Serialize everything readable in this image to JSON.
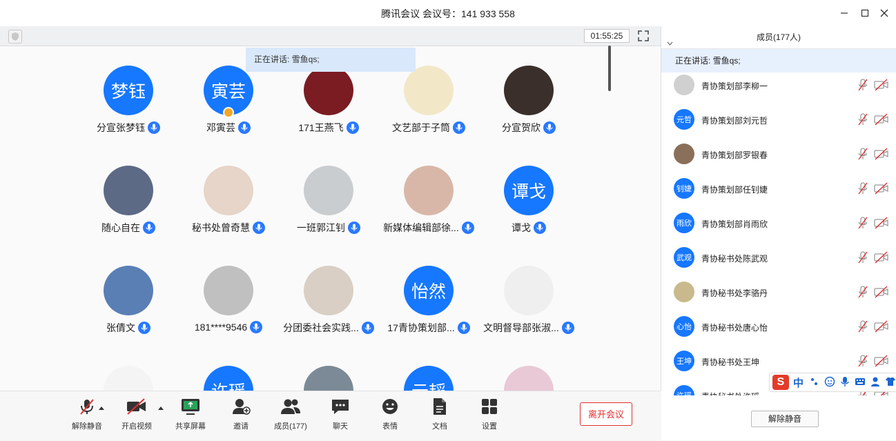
{
  "window": {
    "title": "腾讯会议 会议号：141 933 558"
  },
  "meeting": {
    "timer": "01:55:25",
    "speaking": "正在讲话: 雪鱼qs;"
  },
  "gallery": {
    "rows": [
      [
        {
          "avatar_text": "梦钰",
          "name": "分宣张梦钰"
        },
        {
          "avatar_text": "寅芸",
          "name": "邓寅芸",
          "host_badge": true
        },
        {
          "avatar_text": "",
          "name": "171王燕飞",
          "avatar_color": "#7a1c22"
        },
        {
          "avatar_text": "",
          "name": "文艺部于子筒",
          "avatar_color": "#f2e8c8"
        },
        {
          "avatar_text": "",
          "name": "分宣贺欣",
          "avatar_color": "#3a2f2a"
        }
      ],
      [
        {
          "avatar_text": "",
          "name": "随心自在",
          "avatar_color": "#5c6a86"
        },
        {
          "avatar_text": "",
          "name": "秘书处曾奇慧",
          "avatar_color": "#e6d5c8"
        },
        {
          "avatar_text": "",
          "name": "一班郭江钊",
          "avatar_color": "#c9cdd0"
        },
        {
          "avatar_text": "",
          "name": "新媒体编辑部徐...",
          "avatar_color": "#d8b7a8"
        },
        {
          "avatar_text": "谭戈",
          "name": "谭戈"
        }
      ],
      [
        {
          "avatar_text": "",
          "name": "张倩文",
          "avatar_color": "#5a7fb5"
        },
        {
          "avatar_text": "",
          "name": "181****9546",
          "avatar_color": "#c0c0c0"
        },
        {
          "avatar_text": "",
          "name": "分团委社会实践...",
          "avatar_color": "#d9cfc4"
        },
        {
          "avatar_text": "怡然",
          "name": "17青协策划部..."
        },
        {
          "avatar_text": "",
          "name": "文明督导部张淑...",
          "avatar_color": "#efefef"
        }
      ],
      [
        {
          "avatar_text": "",
          "name": "",
          "avatar_color": "#f4f4f4"
        },
        {
          "avatar_text": "许瑶",
          "name": ""
        },
        {
          "avatar_text": "",
          "name": "",
          "avatar_color": "#7b8a96"
        },
        {
          "avatar_text": "云韬",
          "name": ""
        },
        {
          "avatar_text": "",
          "name": "",
          "avatar_color": "#e9c9d6"
        }
      ]
    ]
  },
  "toolbar": {
    "unmute": "解除静音",
    "start_video": "开启视频",
    "share_screen": "共享屏幕",
    "invite": "邀请",
    "members": "成员(177)",
    "chat": "聊天",
    "reactions": "表情",
    "docs": "文档",
    "settings": "设置",
    "leave": "离开会议"
  },
  "panel": {
    "header": "成员(177人)",
    "speaking": "正在讲话: 雪鱼qs;",
    "members": [
      {
        "avatar_text": "",
        "name": "青协策划部李柳一",
        "avatar_color": "#d0d0d0"
      },
      {
        "avatar_text": "元哲",
        "name": "青协策划部刘元哲"
      },
      {
        "avatar_text": "",
        "name": "青协策划部罗银春",
        "avatar_color": "#8a6f5a"
      },
      {
        "avatar_text": "钊婕",
        "name": "青协策划部任钊婕"
      },
      {
        "avatar_text": "雨欣",
        "name": "青协策划部肖雨欣"
      },
      {
        "avatar_text": "武观",
        "name": "青协秘书处陈武观"
      },
      {
        "avatar_text": "",
        "name": "青协秘书处李骆丹",
        "avatar_color": "#c9b98d"
      },
      {
        "avatar_text": "心怡",
        "name": "青协秘书处唐心怡"
      },
      {
        "avatar_text": "王坤",
        "name": "青协秘书处王坤"
      },
      {
        "avatar_text": "许瑶",
        "name": "青协秘书处许瑶"
      }
    ],
    "unmute_all": "解除静音"
  },
  "ime": {
    "logo": "S",
    "mode": "中"
  },
  "colors": {
    "accent": "#1677ff",
    "leave": "#e02f2f",
    "speaking_bg": "#e7f0fd"
  }
}
